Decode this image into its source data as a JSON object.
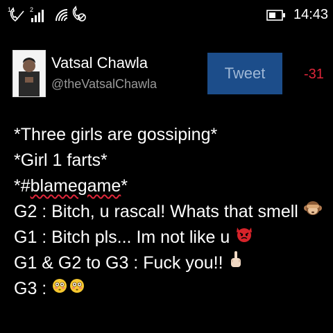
{
  "status": {
    "sim1_index": "1",
    "sim2_index": "2",
    "time": "14:43"
  },
  "compose": {
    "author_name": "Vatsal Chawla",
    "author_handle": "@theVatsalChawla",
    "tweet_label": "Tweet",
    "char_counter": "-31",
    "lines": {
      "l1": "*Three girls are gossiping*",
      "l2": "*Girl 1 farts*",
      "l3_prefix": "*#",
      "l3_tag": "blamegame",
      "l3_suffix": "*",
      "l4": "G2 : Bitch, u rascal! Whats that smell",
      "l5": "G1 : Bitch pls... Im not like u",
      "l6": "G1 & G2 to G3 : Fuck you!!",
      "l7": "G3 :"
    }
  },
  "colors": {
    "background": "#000000",
    "tweet_button": "#1c4d8a",
    "counter_negative": "#e0263a",
    "handle": "#9a9a9a"
  },
  "icons": {
    "emoji_l4": "see-no-evil-monkey-icon",
    "emoji_l5": "angry-devil-icon",
    "emoji_l6": "middle-finger-icon",
    "emoji_l7": "flushed-face-icon"
  }
}
